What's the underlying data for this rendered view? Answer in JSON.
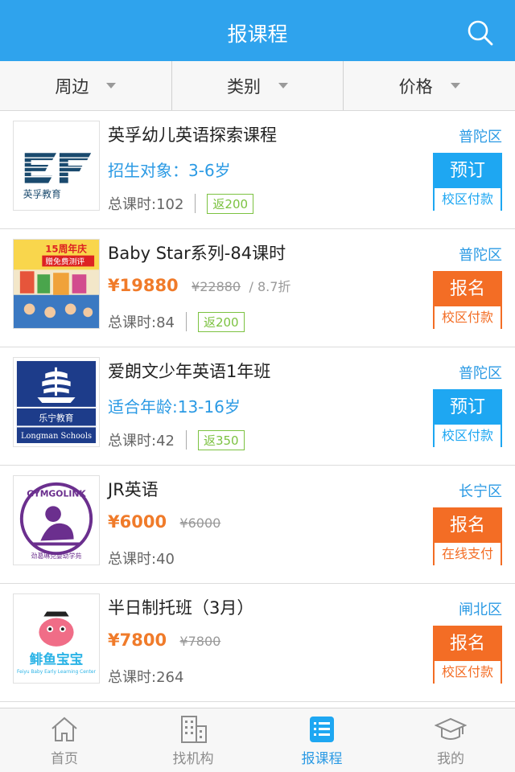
{
  "header": {
    "title": "报课程",
    "search_icon": "search-icon"
  },
  "filters": [
    {
      "label": "周边"
    },
    {
      "label": "类别"
    },
    {
      "label": "价格"
    }
  ],
  "courses": [
    {
      "name": "英孚幼儿英语探索课程",
      "target": "招生对象：3-6岁",
      "hours": "总课时:102",
      "rebate": "返200",
      "district": "普陀区",
      "action": "预订",
      "payment": "校区付款",
      "action_color": "blue",
      "logo": "ef-logo"
    },
    {
      "name": "Baby Star系列-84课时",
      "price": "¥19880",
      "original_price": "¥22880",
      "discount": "/ 8.7折",
      "hours": "总课时:84",
      "rebate": "返200",
      "district": "普陀区",
      "action": "报名",
      "payment": "校区付款",
      "action_color": "orange",
      "logo": "babystar-photo",
      "logo_text": "15周年庆 赠免费测评"
    },
    {
      "name": "爱朗文少年英语1年班",
      "target": "适合年龄:13-16岁",
      "hours": "总课时:42",
      "rebate": "返350",
      "district": "普陀区",
      "action": "预订",
      "payment": "校区付款",
      "action_color": "blue",
      "logo": "longman-logo",
      "logo_text_cn": "乐宁教育",
      "logo_text_en": "Longman Schools"
    },
    {
      "name": "JR英语",
      "price": "¥6000",
      "original_price": "¥6000",
      "hours": "总课时:40",
      "district": "长宁区",
      "action": "报名",
      "payment": "在线支付",
      "action_color": "orange",
      "logo": "gymgolink-logo",
      "logo_text": "GYMGOLINK"
    },
    {
      "name": "半日制托班（3月）",
      "price": "¥7800",
      "original_price": "¥7800",
      "hours": "总课时:264",
      "district": "闸北区",
      "action": "报名",
      "payment": "校区付款",
      "action_color": "orange",
      "logo": "feiyu-logo",
      "logo_text": "鲱鱼宝宝"
    }
  ],
  "tabs": [
    {
      "label": "首页",
      "icon": "home-icon",
      "active": false
    },
    {
      "label": "找机构",
      "icon": "building-icon",
      "active": false
    },
    {
      "label": "报课程",
      "icon": "list-icon",
      "active": true
    },
    {
      "label": "我的",
      "icon": "graduation-cap-icon",
      "active": false
    }
  ],
  "colors": {
    "header": "#2fa3ed",
    "accent_blue": "#1ea7f2",
    "accent_orange": "#f36d25",
    "price": "#f07b2a",
    "rebate": "#7cc241"
  }
}
